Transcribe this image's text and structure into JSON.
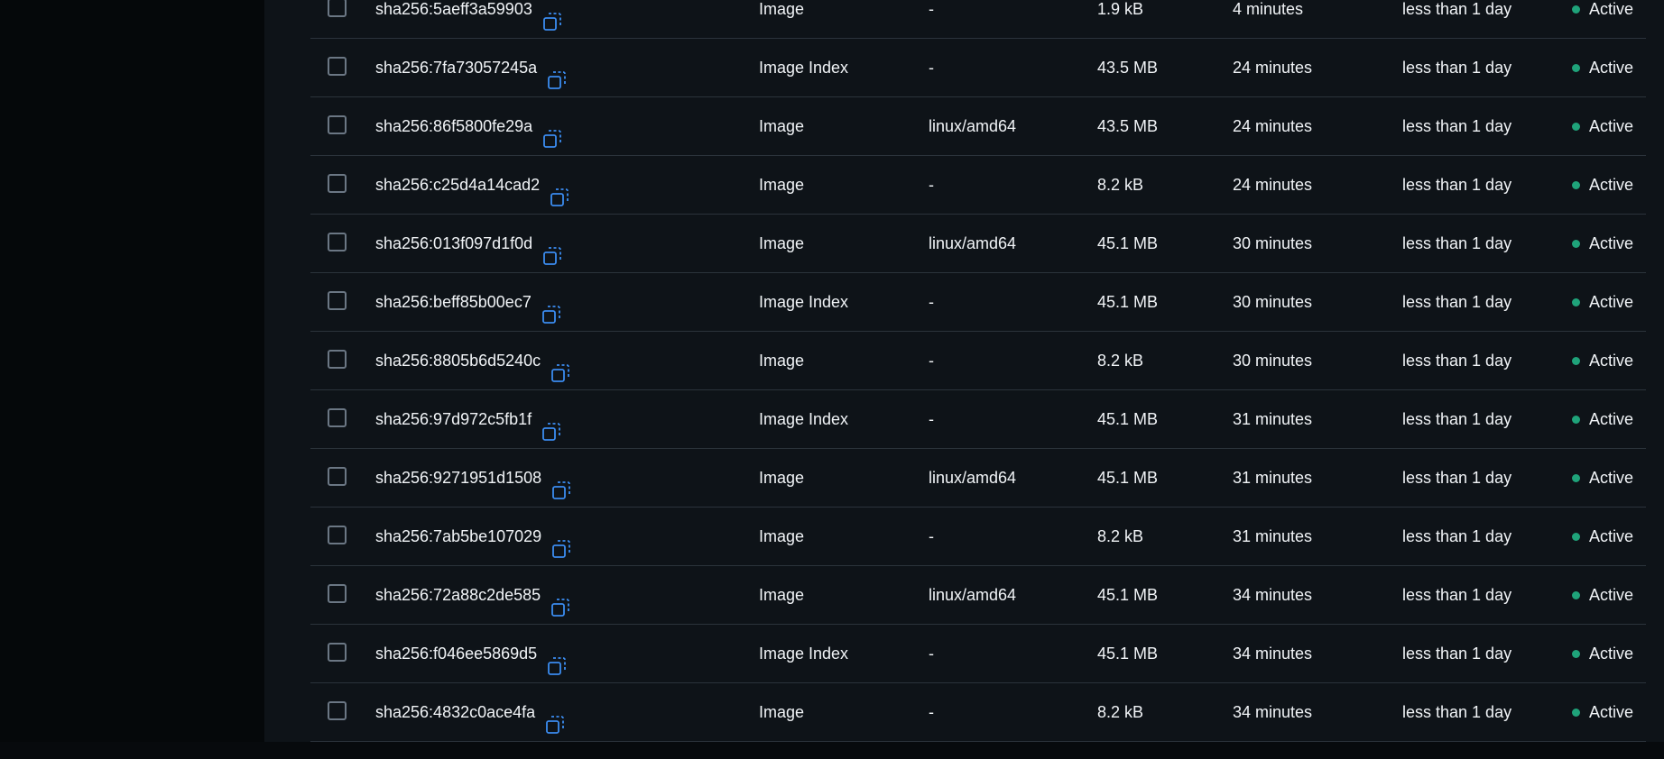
{
  "colors": {
    "active_dot": "#1fa37a",
    "copy_icon": "#3b8cf0"
  },
  "rows": [
    {
      "digest": "sha256:5aeff3a59903",
      "type": "Image",
      "platform": "-",
      "size": "1.9 kB",
      "pushed": "4 minutes",
      "pulled": "less than 1 day",
      "status": "Active",
      "icon": "copy-icon"
    },
    {
      "digest": "sha256:7fa73057245a",
      "type": "Image Index",
      "platform": "-",
      "size": "43.5 MB",
      "pushed": "24 minutes",
      "pulled": "less than 1 day",
      "status": "Active",
      "icon": "copy-icon"
    },
    {
      "digest": "sha256:86f5800fe29a",
      "type": "Image",
      "platform": "linux/amd64",
      "size": "43.5 MB",
      "pushed": "24 minutes",
      "pulled": "less than 1 day",
      "status": "Active",
      "icon": "copy-icon"
    },
    {
      "digest": "sha256:c25d4a14cad2",
      "type": "Image",
      "platform": "-",
      "size": "8.2 kB",
      "pushed": "24 minutes",
      "pulled": "less than 1 day",
      "status": "Active",
      "icon": "copy-icon"
    },
    {
      "digest": "sha256:013f097d1f0d",
      "type": "Image",
      "platform": "linux/amd64",
      "size": "45.1 MB",
      "pushed": "30 minutes",
      "pulled": "less than 1 day",
      "status": "Active",
      "icon": "copy-icon"
    },
    {
      "digest": "sha256:beff85b00ec7",
      "type": "Image Index",
      "platform": "-",
      "size": "45.1 MB",
      "pushed": "30 minutes",
      "pulled": "less than 1 day",
      "status": "Active",
      "icon": "copy-icon"
    },
    {
      "digest": "sha256:8805b6d5240c",
      "type": "Image",
      "platform": "-",
      "size": "8.2 kB",
      "pushed": "30 minutes",
      "pulled": "less than 1 day",
      "status": "Active",
      "icon": "copy-icon"
    },
    {
      "digest": "sha256:97d972c5fb1f",
      "type": "Image Index",
      "platform": "-",
      "size": "45.1 MB",
      "pushed": "31 minutes",
      "pulled": "less than 1 day",
      "status": "Active",
      "icon": "copy-icon"
    },
    {
      "digest": "sha256:9271951d1508",
      "type": "Image",
      "platform": "linux/amd64",
      "size": "45.1 MB",
      "pushed": "31 minutes",
      "pulled": "less than 1 day",
      "status": "Active",
      "icon": "copy-icon"
    },
    {
      "digest": "sha256:7ab5be107029",
      "type": "Image",
      "platform": "-",
      "size": "8.2 kB",
      "pushed": "31 minutes",
      "pulled": "less than 1 day",
      "status": "Active",
      "icon": "copy-icon"
    },
    {
      "digest": "sha256:72a88c2de585",
      "type": "Image",
      "platform": "linux/amd64",
      "size": "45.1 MB",
      "pushed": "34 minutes",
      "pulled": "less than 1 day",
      "status": "Active",
      "icon": "copy-icon"
    },
    {
      "digest": "sha256:f046ee5869d5",
      "type": "Image Index",
      "platform": "-",
      "size": "45.1 MB",
      "pushed": "34 minutes",
      "pulled": "less than 1 day",
      "status": "Active",
      "icon": "copy-icon"
    },
    {
      "digest": "sha256:4832c0ace4fa",
      "type": "Image",
      "platform": "-",
      "size": "8.2 kB",
      "pushed": "34 minutes",
      "pulled": "less than 1 day",
      "status": "Active",
      "icon": "copy-icon"
    }
  ]
}
